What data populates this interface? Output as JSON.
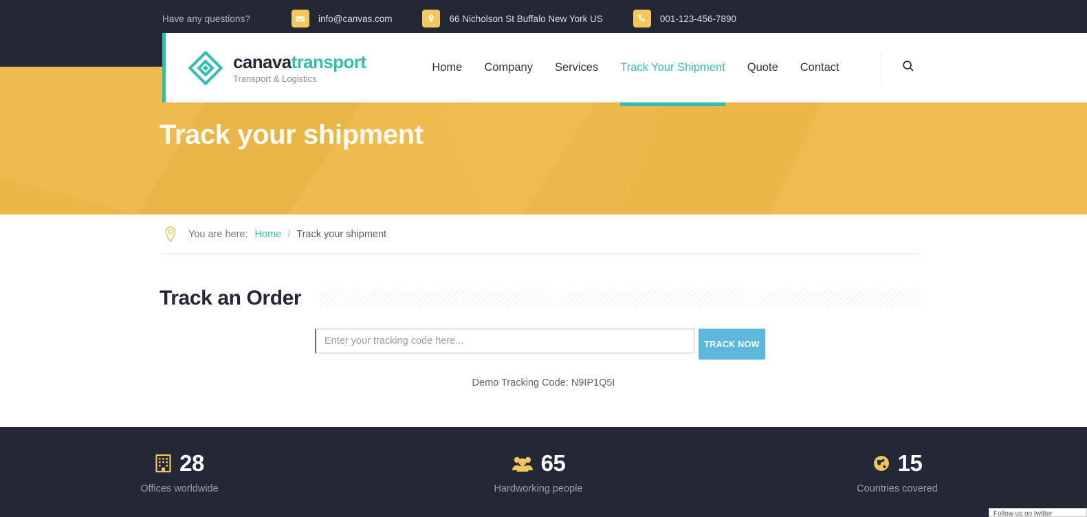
{
  "topbar": {
    "question_label": "Have any questions?",
    "items": [
      {
        "icon": "envelope-icon",
        "text": "info@canvas.com"
      },
      {
        "icon": "map-pin-icon",
        "text": "66 Nicholson St Buffalo New York US"
      },
      {
        "icon": "phone-icon",
        "text": "001-123-456-7890"
      }
    ]
  },
  "header": {
    "logo": {
      "icon": "diamond-logo-icon",
      "name_part1": "canava",
      "name_part2": "transport",
      "tagline": "Transport & Logistics"
    },
    "nav": [
      {
        "label": "Home",
        "active": false
      },
      {
        "label": "Company",
        "active": false
      },
      {
        "label": "Services",
        "active": false
      },
      {
        "label": "Track Your Shipment",
        "active": true
      },
      {
        "label": "Quote",
        "active": false
      },
      {
        "label": "Contact",
        "active": false
      }
    ],
    "search_icon": "search-icon"
  },
  "hero": {
    "title": "Track your shipment"
  },
  "breadcrumb": {
    "pin_icon": "map-pin-outline-icon",
    "label": "You are here:",
    "home": "Home",
    "separator": "/",
    "current": "Track your shipment"
  },
  "main": {
    "section_title": "Track an Order",
    "input_placeholder": "Enter your tracking code here...",
    "input_value": "",
    "button_label": "TRACK NOW",
    "demo_code": "Demo Tracking Code: N9IP1Q5I"
  },
  "stats": [
    {
      "icon": "building-icon",
      "number": "28",
      "label": "Offices worldwide"
    },
    {
      "icon": "people-group-icon",
      "number": "65",
      "label": "Hardworking people"
    },
    {
      "icon": "globe-icon",
      "number": "15",
      "label": "Countries covered"
    }
  ],
  "corner_widget": {
    "text": "Follow us on twitter"
  },
  "colors": {
    "dark": "#242836",
    "teal": "#2fbfae",
    "yellow": "#efb949",
    "icon_yellow": "#f5c85c",
    "button_blue": "#5cb8dd"
  }
}
